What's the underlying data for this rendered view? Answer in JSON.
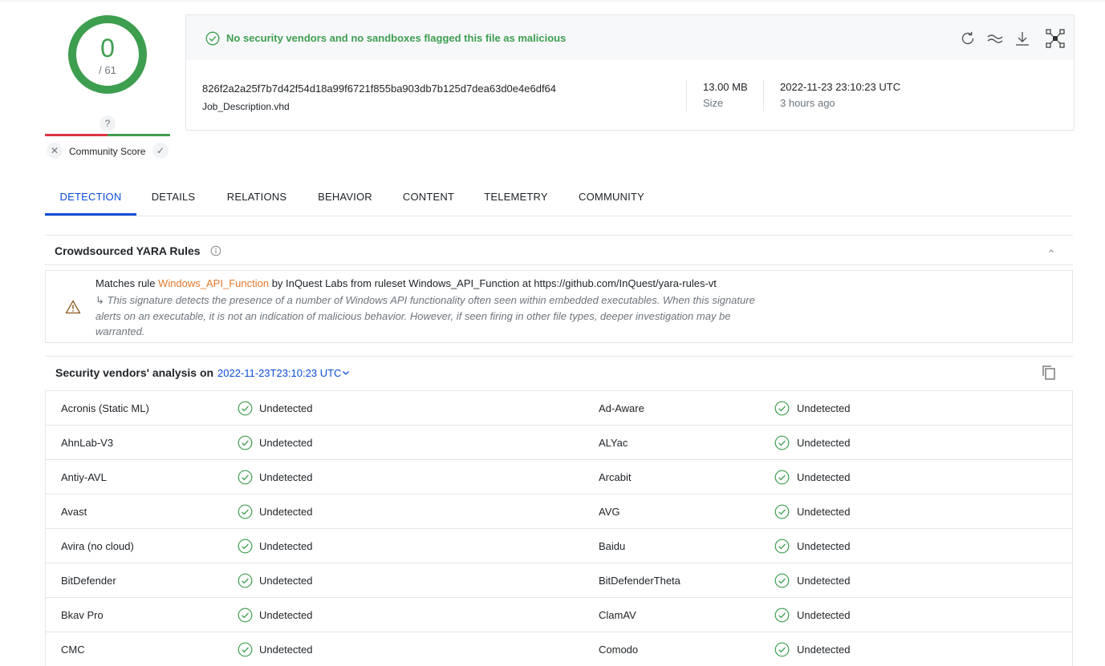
{
  "score": {
    "detections": "0",
    "total": "/ 61",
    "community_question": "?",
    "community_label": "Community Score",
    "colors": {
      "good": "#3e9e4f",
      "bad": "#dc3545"
    }
  },
  "file": {
    "banner": "No security vendors and no sandboxes flagged this file as malicious",
    "hash": "826f2a2a25f7b7d42f54d18a99f6721f855ba903db7b125d7dea63d0e4e6df64",
    "name": "Job_Description.vhd",
    "size_value": "13.00 MB",
    "size_label": "Size",
    "date_value": "2022-11-23 23:10:23 UTC",
    "date_ago": "3 hours ago",
    "toolbar_icons": [
      "reanalyze-icon",
      "similar-icon",
      "download-icon",
      "graph-icon"
    ]
  },
  "tabs": [
    {
      "label": "DETECTION",
      "active": true
    },
    {
      "label": "DETAILS"
    },
    {
      "label": "RELATIONS"
    },
    {
      "label": "BEHAVIOR"
    },
    {
      "label": "CONTENT"
    },
    {
      "label": "TELEMETRY"
    },
    {
      "label": "COMMUNITY"
    }
  ],
  "yara": {
    "title": "Crowdsourced YARA Rules",
    "prefix": "Matches rule",
    "rule": "Windows_API_Function",
    "middle": "by InQuest Labs from ruleset Windows_API_Function at https://github.com/InQuest/yara-rules-vt",
    "description": "↳ This signature detects the presence of a number of Windows API functionality often seen within embedded executables. When this signature alerts on an executable, it is not an indication of malicious behavior. However, if seen firing in other file types, deeper investigation may be warranted.",
    "rule_color": "#e0782e"
  },
  "vendors": {
    "title": "Security vendors' analysis on",
    "date": "2022-11-23T23:10:23 UTC",
    "rows": [
      {
        "left": "Acronis (Static ML)",
        "left_result": "Undetected",
        "right": "Ad-Aware",
        "right_result": "Undetected"
      },
      {
        "left": "AhnLab-V3",
        "left_result": "Undetected",
        "right": "ALYac",
        "right_result": "Undetected"
      },
      {
        "left": "Antiy-AVL",
        "left_result": "Undetected",
        "right": "Arcabit",
        "right_result": "Undetected"
      },
      {
        "left": "Avast",
        "left_result": "Undetected",
        "right": "AVG",
        "right_result": "Undetected"
      },
      {
        "left": "Avira (no cloud)",
        "left_result": "Undetected",
        "right": "Baidu",
        "right_result": "Undetected"
      },
      {
        "left": "BitDefender",
        "left_result": "Undetected",
        "right": "BitDefenderTheta",
        "right_result": "Undetected"
      },
      {
        "left": "Bkav Pro",
        "left_result": "Undetected",
        "right": "ClamAV",
        "right_result": "Undetected"
      },
      {
        "left": "CMC",
        "left_result": "Undetected",
        "right": "Comodo",
        "right_result": "Undetected"
      }
    ]
  }
}
